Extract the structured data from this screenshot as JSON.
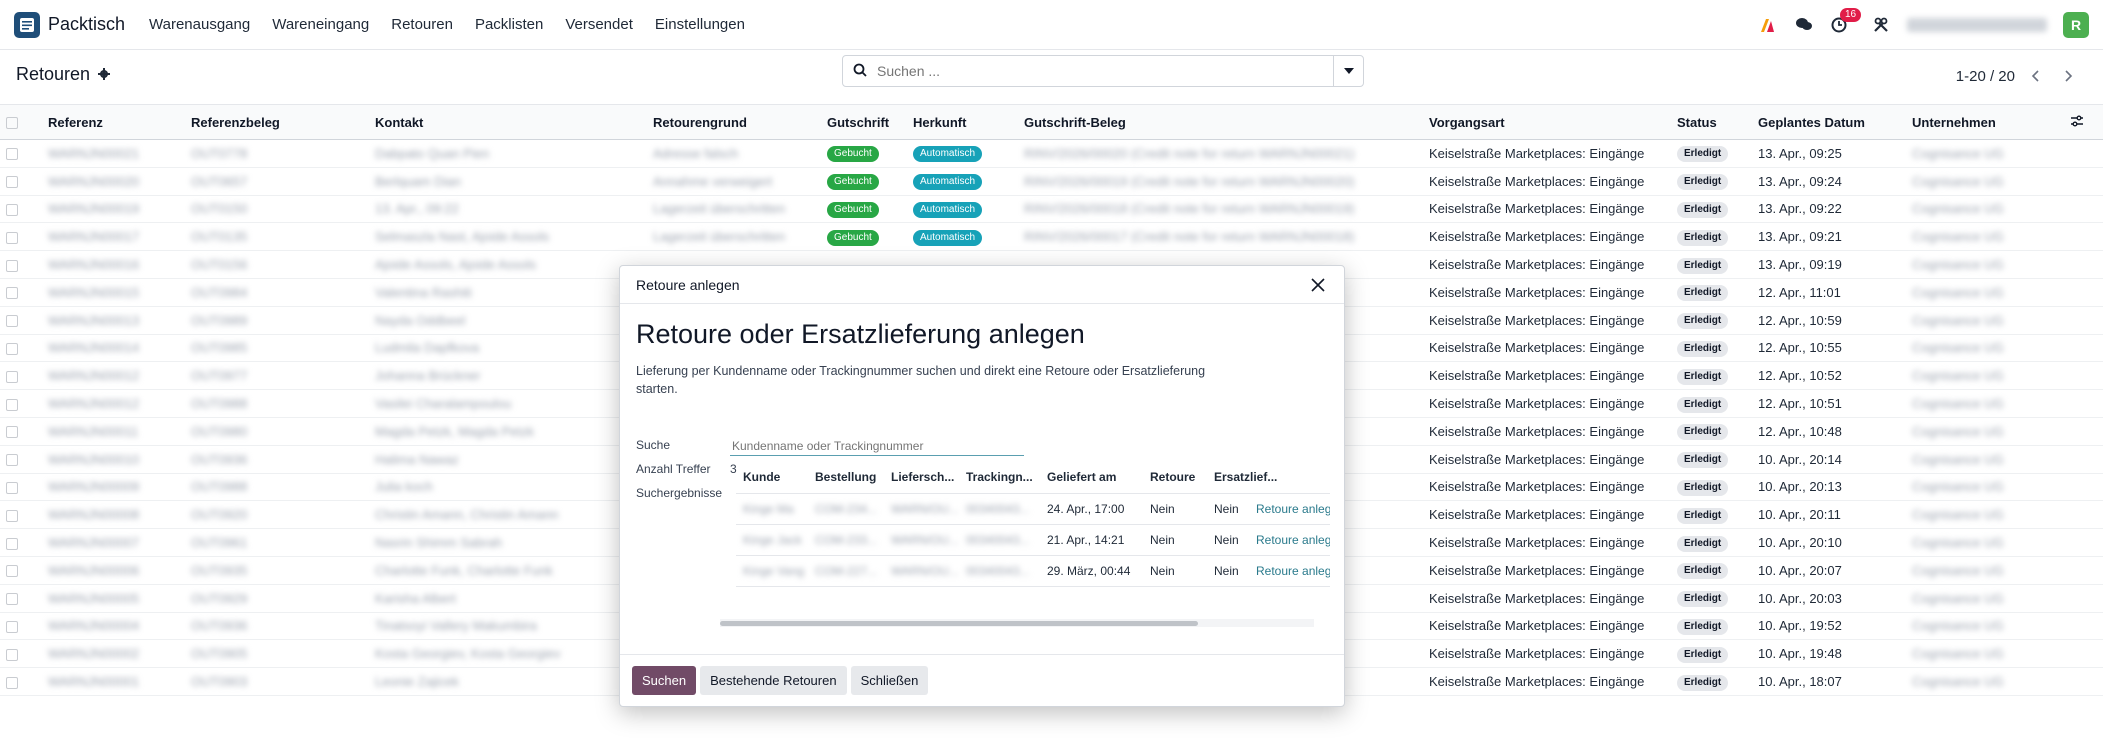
{
  "navbar": {
    "app_name": "Packtisch",
    "menu": [
      "Warenausgang",
      "Wareneingang",
      "Retouren",
      "Packlisten",
      "Versendet",
      "Einstellungen"
    ],
    "activity_count": "16",
    "avatar_letter": "R"
  },
  "control": {
    "title": "Retouren",
    "search_placeholder": "Suchen ...",
    "pager": "1-20 / 20"
  },
  "table": {
    "headers": [
      "Referenz",
      "Referenzbeleg",
      "Kontakt",
      "Retourengrund",
      "Gutschrift",
      "Herkunft",
      "Gutschrift-Beleg",
      "Vorgangsart",
      "Status",
      "Geplantes Datum",
      "Unternehmen"
    ],
    "rows": [
      {
        "ref": "WARNJN00021",
        "refdoc": "OUT0778",
        "contact": "Dabpato Quan Pien",
        "reason": "Adresse falsch",
        "credit": "Gebucht",
        "origin": "Automatisch",
        "creditdoc": "RINV/2026/00020 (Credit note for return WARNJN00021)",
        "type": "Keiselstraße Marketplaces: Eingänge",
        "status": "Erledigt",
        "date": "13. Apr., 09:25",
        "company": "Cognisance UG"
      },
      {
        "ref": "WARNJN00020",
        "refdoc": "OUT0657",
        "contact": "Berlquam Dian",
        "reason": "Annahme verweigert",
        "credit": "Gebucht",
        "origin": "Automatisch",
        "creditdoc": "RINV/2026/00019 (Credit note for return WARNJN00020)",
        "type": "Keiselstraße Marketplaces: Eingänge",
        "status": "Erledigt",
        "date": "13. Apr., 09:24",
        "company": "Cognisance UG"
      },
      {
        "ref": "WARNJN00019",
        "refdoc": "OUT0150",
        "contact": "13. Apr., 09:22",
        "reason": "Lagerzeit überschritten",
        "credit": "Gebucht",
        "origin": "Automatisch",
        "creditdoc": "RINV/2026/00018 (Credit note for return WARNJN00019)",
        "type": "Keiselstraße Marketplaces: Eingänge",
        "status": "Erledigt",
        "date": "13. Apr., 09:22",
        "company": "Cognisance UG"
      },
      {
        "ref": "WARNJN00017",
        "refdoc": "OUT0135",
        "contact": "Selmaszla Nast, Ajoide Assols",
        "reason": "Lagerzeit überschritten",
        "credit": "Gebucht",
        "origin": "Automatisch",
        "creditdoc": "RINV/2026/00017 (Credit note for return WARNJN00018)",
        "type": "Keiselstraße Marketplaces: Eingänge",
        "status": "Erledigt",
        "date": "13. Apr., 09:21",
        "company": "Cognisance UG"
      },
      {
        "ref": "WARNJN00016",
        "refdoc": "OUT0156",
        "contact": "Ajoide Assols, Ajoide Assols",
        "reason": "",
        "credit": "",
        "origin": "",
        "creditdoc": "",
        "type": "Keiselstraße Marketplaces: Eingänge",
        "status": "Erledigt",
        "date": "13. Apr., 09:19",
        "company": "Cognisance UG"
      },
      {
        "ref": "WARNJN00015",
        "refdoc": "OUT0984",
        "contact": "Valentina Rashiti",
        "reason": "",
        "credit": "",
        "origin": "",
        "creditdoc": "",
        "type": "Keiselstraße Marketplaces: Eingänge",
        "status": "Erledigt",
        "date": "12. Apr., 11:01",
        "company": "Cognisance UG"
      },
      {
        "ref": "WARNJN00013",
        "refdoc": "OUT0989",
        "contact": "Nayda Oddbeel",
        "reason": "",
        "credit": "",
        "origin": "",
        "creditdoc": "",
        "type": "Keiselstraße Marketplaces: Eingänge",
        "status": "Erledigt",
        "date": "12. Apr., 10:59",
        "company": "Cognisance UG"
      },
      {
        "ref": "WARNJN00014",
        "refdoc": "OUT0985",
        "contact": "Ludmila Dapfkova",
        "reason": "",
        "credit": "",
        "origin": "",
        "creditdoc": "",
        "type": "Keiselstraße Marketplaces: Eingänge",
        "status": "Erledigt",
        "date": "12. Apr., 10:55",
        "company": "Cognisance UG"
      },
      {
        "ref": "WARNJN00012",
        "refdoc": "OUT0977",
        "contact": "Johanna Brückner",
        "reason": "",
        "credit": "",
        "origin": "",
        "creditdoc": "",
        "type": "Keiselstraße Marketplaces: Eingänge",
        "status": "Erledigt",
        "date": "12. Apr., 10:52",
        "company": "Cognisance UG"
      },
      {
        "ref": "WARNJN00012",
        "refdoc": "OUT0988",
        "contact": "Vasilei Charalampoulou",
        "reason": "",
        "credit": "",
        "origin": "",
        "creditdoc": "",
        "type": "Keiselstraße Marketplaces: Eingänge",
        "status": "Erledigt",
        "date": "12. Apr., 10:51",
        "company": "Cognisance UG"
      },
      {
        "ref": "WARNJN00011",
        "refdoc": "OUT0980",
        "contact": "Magda Petzk, Magda Petzk",
        "reason": "",
        "credit": "",
        "origin": "",
        "creditdoc": "",
        "type": "Keiselstraße Marketplaces: Eingänge",
        "status": "Erledigt",
        "date": "12. Apr., 10:48",
        "company": "Cognisance UG"
      },
      {
        "ref": "WARNJN00010",
        "refdoc": "OUT0936",
        "contact": "Halima Nawaz",
        "reason": "",
        "credit": "",
        "origin": "",
        "creditdoc": "",
        "type": "Keiselstraße Marketplaces: Eingänge",
        "status": "Erledigt",
        "date": "10. Apr., 20:14",
        "company": "Cognisance UG"
      },
      {
        "ref": "WARNJN00009",
        "refdoc": "OUT0988",
        "contact": "Julia koch",
        "reason": "",
        "credit": "",
        "origin": "",
        "creditdoc": "",
        "type": "Keiselstraße Marketplaces: Eingänge",
        "status": "Erledigt",
        "date": "10. Apr., 20:13",
        "company": "Cognisance UG"
      },
      {
        "ref": "WARNJN00008",
        "refdoc": "OUT0920",
        "contact": "Christin Amann, Christin Amann",
        "reason": "",
        "credit": "",
        "origin": "",
        "creditdoc": "",
        "type": "Keiselstraße Marketplaces: Eingänge",
        "status": "Erledigt",
        "date": "10. Apr., 20:11",
        "company": "Cognisance UG"
      },
      {
        "ref": "WARNJN00007",
        "refdoc": "OUT0961",
        "contact": "Nasrin Shimm Sabrah",
        "reason": "",
        "credit": "",
        "origin": "",
        "creditdoc": "",
        "type": "Keiselstraße Marketplaces: Eingänge",
        "status": "Erledigt",
        "date": "10. Apr., 20:10",
        "company": "Cognisance UG"
      },
      {
        "ref": "WARNJN00006",
        "refdoc": "OUT0935",
        "contact": "Charlotte Funk, Charlotte Funk",
        "reason": "",
        "credit": "",
        "origin": "",
        "creditdoc": "",
        "type": "Keiselstraße Marketplaces: Eingänge",
        "status": "Erledigt",
        "date": "10. Apr., 20:07",
        "company": "Cognisance UG"
      },
      {
        "ref": "WARNJN00005",
        "refdoc": "OUT0929",
        "contact": "Karisha Albert",
        "reason": "",
        "credit": "",
        "origin": "",
        "creditdoc": "",
        "type": "Keiselstraße Marketplaces: Eingänge",
        "status": "Erledigt",
        "date": "10. Apr., 20:03",
        "company": "Cognisance UG"
      },
      {
        "ref": "WARNJN00004",
        "refdoc": "OUT0936",
        "contact": "Tinatsoyi Vallery Makumbira",
        "reason": "",
        "credit": "",
        "origin": "",
        "creditdoc": "",
        "type": "Keiselstraße Marketplaces: Eingänge",
        "status": "Erledigt",
        "date": "10. Apr., 19:52",
        "company": "Cognisance UG"
      },
      {
        "ref": "WARNJN00002",
        "refdoc": "OUT0905",
        "contact": "Kosta Georgiev, Kosta Georgiev",
        "reason": "",
        "credit": "",
        "origin": "",
        "creditdoc": "",
        "type": "Keiselstraße Marketplaces: Eingänge",
        "status": "Erledigt",
        "date": "10. Apr., 19:48",
        "company": "Cognisance UG"
      },
      {
        "ref": "WARNJN00001",
        "refdoc": "OUT0903",
        "contact": "Leonie Zajicek",
        "reason": "",
        "credit": "",
        "origin": "",
        "creditdoc": "",
        "type": "Keiselstraße Marketplaces: Eingänge",
        "status": "Erledigt",
        "date": "10. Apr., 18:07",
        "company": "Cognisance UG"
      }
    ]
  },
  "modal": {
    "title": "Retoure anlegen",
    "heading": "Retoure oder Ersatzlieferung anlegen",
    "description": "Lieferung per Kundenname oder Trackingnummer suchen und direkt eine Retoure oder Ersatzlieferung starten.",
    "search_label": "Suche",
    "search_placeholder": "Kundenname oder Trackingnummer",
    "hits_label": "Anzahl Treffer",
    "hits_value": "3",
    "results_label": "Suchergebnisse",
    "result_headers": [
      "Kunde",
      "Bestellung",
      "Liefersch...",
      "Trackingn...",
      "Geliefert am",
      "Retoure",
      "Ersatzlief..."
    ],
    "results": [
      {
        "customer": "Kinge Ma",
        "order": "COM-234...",
        "delivery": "WARN/OU...",
        "tracking": "00340043...",
        "delivered": "24. Apr., 17:00",
        "return": "Nein",
        "replacement": "Nein",
        "action": "Retoure anlegen"
      },
      {
        "customer": "Kinge Jack",
        "order": "COM-233...",
        "delivery": "WARN/OU...",
        "tracking": "00340043...",
        "delivered": "21. Apr., 14:21",
        "return": "Nein",
        "replacement": "Nein",
        "action": "Retoure anlegen"
      },
      {
        "customer": "Kinge Vang",
        "order": "COM-227...",
        "delivery": "WARN/OU...",
        "tracking": "00340043...",
        "delivered": "29. März, 00:44",
        "return": "Nein",
        "replacement": "Nein",
        "action": "Retoure anlegen"
      }
    ],
    "btn_search": "Suchen",
    "btn_existing": "Bestehende Retouren",
    "btn_close": "Schließen"
  }
}
